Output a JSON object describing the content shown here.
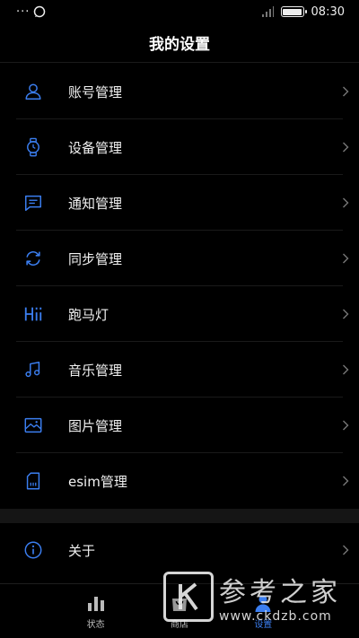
{
  "status_bar": {
    "left_icons": [
      "more-dots-icon",
      "chat-bubble-icon"
    ],
    "signal": "signal-icon",
    "time": "08:30",
    "battery_level": 1.0
  },
  "header": {
    "title": "我的设置"
  },
  "settings": {
    "items": [
      {
        "label": "账号管理",
        "icon": "person-icon"
      },
      {
        "label": "设备管理",
        "icon": "watch-icon"
      },
      {
        "label": "通知管理",
        "icon": "message-icon"
      },
      {
        "label": "同步管理",
        "icon": "sync-icon"
      },
      {
        "label": "跑马灯",
        "icon": "hi-icon"
      },
      {
        "label": "音乐管理",
        "icon": "music-icon"
      },
      {
        "label": "图片管理",
        "icon": "image-icon"
      },
      {
        "label": "esim管理",
        "icon": "sim-card-icon"
      }
    ],
    "about": {
      "label": "关于",
      "icon": "info-icon"
    }
  },
  "tab_bar": {
    "tabs": [
      {
        "label": "状态",
        "icon": "bar-chart-icon",
        "active": false
      },
      {
        "label": "商店",
        "icon": "shopping-bag-icon",
        "active": false
      },
      {
        "label": "设置",
        "icon": "profile-icon",
        "active": true
      }
    ]
  },
  "watermark": {
    "text": "参考之家",
    "url": "www.ckdzb.com"
  },
  "colors": {
    "accent": "#3b7ef0",
    "background": "#000000",
    "text": "#f2f2f2",
    "divider": "#1a1a1a"
  }
}
